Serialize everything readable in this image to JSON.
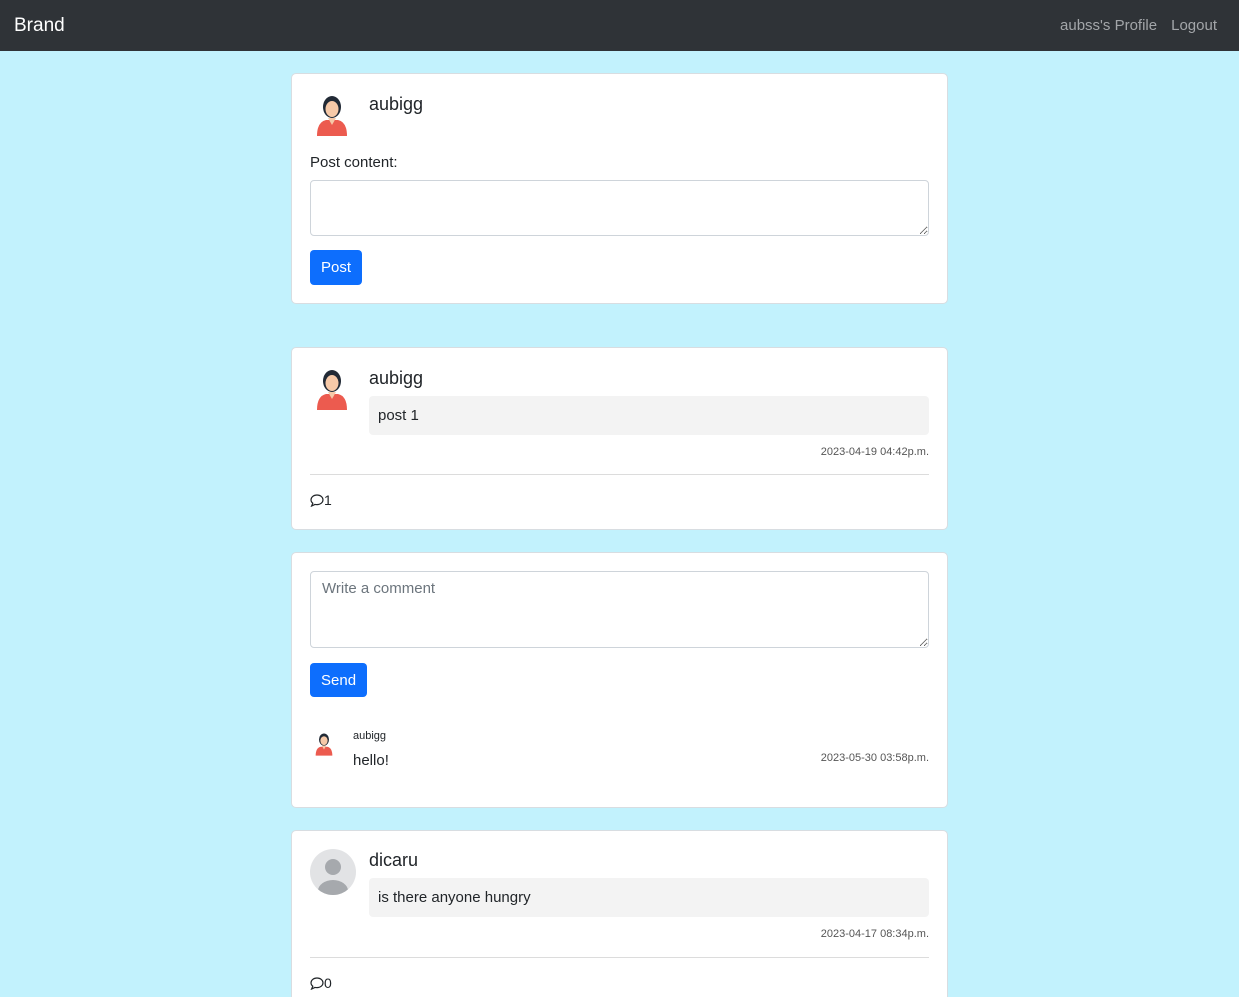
{
  "navbar": {
    "brand": "Brand",
    "profile_link": "aubss's Profile",
    "logout_link": "Logout"
  },
  "composer": {
    "username": "aubigg",
    "label": "Post content:",
    "content_value": "",
    "post_button": "Post"
  },
  "posts": [
    {
      "username": "aubigg",
      "avatar": "female-avatar-icon",
      "content": "post 1",
      "timestamp": "2023-04-19 04:42p.m.",
      "comment_count": "1"
    },
    {
      "username": "dicaru",
      "avatar": "default-avatar-icon",
      "content": "is there anyone hungry",
      "timestamp": "2023-04-17 08:34p.m.",
      "comment_count": "0"
    }
  ],
  "comment_section": {
    "placeholder": "Write a comment",
    "send_button": "Send",
    "comments": [
      {
        "username": "aubigg",
        "text": "hello!",
        "timestamp": "2023-05-30 03:58p.m."
      }
    ]
  },
  "colors": {
    "background": "#c2f2fd",
    "navbar": "#2f3337",
    "primary_button": "#0d6efd"
  }
}
